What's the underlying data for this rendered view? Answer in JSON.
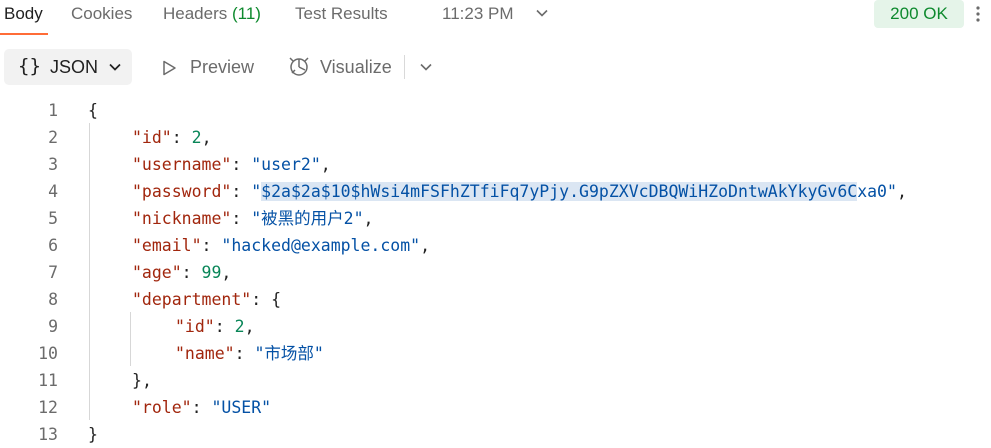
{
  "tabs": [
    {
      "label": "Body"
    },
    {
      "label": "Cookies"
    },
    {
      "label": "Headers",
      "count": "(11)"
    },
    {
      "label": "Test Results"
    }
  ],
  "time": "11:23 PM",
  "status": "200 OK",
  "toolbar": {
    "format_label": "JSON",
    "preview_label": "Preview",
    "visualize_label": "Visualize"
  },
  "code": {
    "line_numbers": [
      "1",
      "2",
      "3",
      "4",
      "5",
      "6",
      "7",
      "8",
      "9",
      "10",
      "11",
      "12",
      "13"
    ],
    "open_brace": "{",
    "close_brace": "}",
    "id_key": "\"id\"",
    "id_val": "2",
    "username_key": "\"username\"",
    "username_val": "\"user2\"",
    "password_key": "\"password\"",
    "password_q1": "\"",
    "password_hl": "$2a$2a$10$hWsi4mFSFhZTfiFq7yPjy.G9pZXVcDBQWiHZoDntwAkYkyGv6C",
    "password_tail": "xa0\"",
    "nickname_key": "\"nickname\"",
    "nickname_val": "\"被黑的用户2\"",
    "email_key": "\"email\"",
    "email_val": "\"hacked@example.com\"",
    "age_key": "\"age\"",
    "age_val": "99",
    "department_key": "\"department\"",
    "dept_id_key": "\"id\"",
    "dept_id_val": "2",
    "dept_name_key": "\"name\"",
    "dept_name_val": "\"市场部\"",
    "role_key": "\"role\"",
    "role_val": "\"USER\""
  },
  "colors": {
    "accent": "#ff6c37",
    "status_green": "#0e8a2e",
    "json_key": "#a1260d",
    "json_string": "#0451a5",
    "json_number": "#098658",
    "selection": "#dbe6f3"
  }
}
